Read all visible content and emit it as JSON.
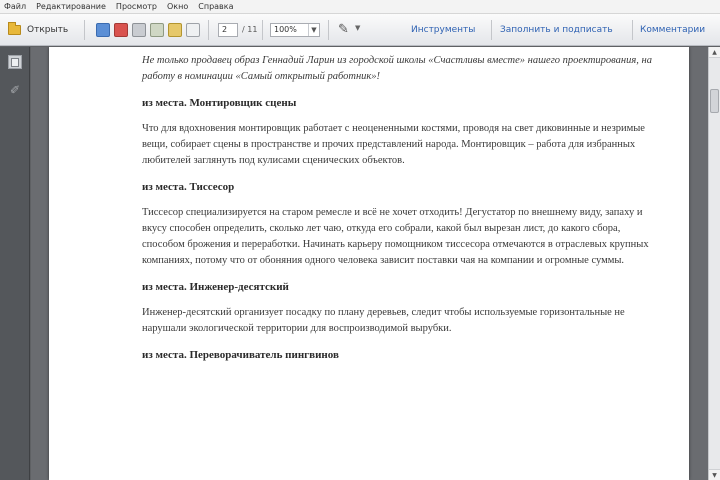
{
  "menu": {
    "items": [
      "Файл",
      "Редактирование",
      "Просмотр",
      "Окно",
      "Справка"
    ]
  },
  "toolbar": {
    "open_label": "Открыть",
    "page_current": "2",
    "page_total": "/ 11",
    "zoom": "100%",
    "tools_label": "Инструменты",
    "sign_label": "Заполнить и подписать",
    "comment_label": "Комментарии"
  },
  "document": {
    "intro": "Не только продавец образ Геннадий Ларин из городской школы «Счастливы вместе» нашего проектирования, на работу в номинации «Самый открытый работник»!",
    "sections": [
      {
        "heading": "из места. Монтировщик сцены",
        "text": "Что для вдохновения монтировщик работает с неоцененными костями, проводя на свет диковинные и незримые вещи, собирает сцены в пространстве и прочих представлений народа. Монтировщик – работа для избранных любителей заглянуть под кулисами сценических объектов."
      },
      {
        "heading": "из места. Тиссесор",
        "text": "Тиссесор специализируется на старом ремесле и всё не хочет отходить! Дегустатор по внешнему виду, запаху и вкусу способен определить, сколько лет чаю, откуда его собрали, какой был вырезан лист, до какого сбора, способом брожения и переработки. Начинать карьеру помощником тиссесора отмечаются в отраслевых крупных компаниях, потому что от обоняния одного человека зависит поставки чая на компании и огромные суммы."
      },
      {
        "heading": "из места. Инженер-десятский",
        "text": "Инженер-десятский организует посадку по плану деревьев, следит чтобы используемые горизонтальные не нарушали экологической территории для воспроизводимой вырубки."
      },
      {
        "heading": "из места. Переворачиватель пингвинов",
        "text": ""
      }
    ]
  },
  "colors": {
    "workspace": "#6a6c70",
    "left_pane": "#54575b",
    "link_blue": "#2f62b3",
    "page_bg": "#ffffff"
  }
}
